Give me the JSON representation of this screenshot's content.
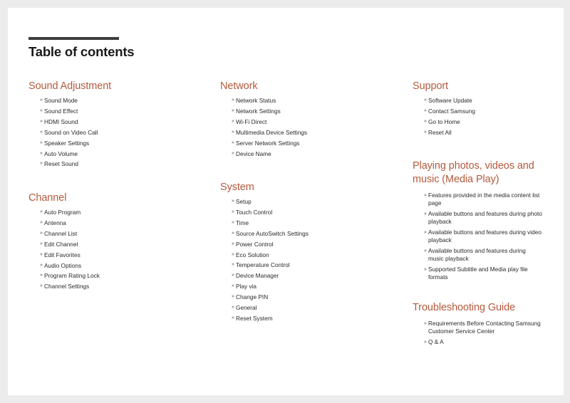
{
  "page": {
    "title": "Table of contents",
    "accent_color": "#b45a3c",
    "bullet_glyph": "»"
  },
  "sections": {
    "sound": {
      "heading": "Sound Adjustment",
      "items": [
        "Sound Mode",
        "Sound Effect",
        "HDMI Sound",
        "Sound on Video Call",
        "Speaker Settings",
        "Auto Volume",
        "Reset Sound"
      ]
    },
    "channel": {
      "heading": "Channel",
      "items": [
        "Auto Program",
        "Antenna",
        "Channel List",
        "Edit Channel",
        "Edit Favorites",
        "Audio Options",
        "Program Rating Lock",
        "Channel Settings"
      ]
    },
    "network": {
      "heading": "Network",
      "items": [
        "Network Status",
        "Network Settings",
        "Wi-Fi Direct",
        "Multimedia Device Settings",
        "Server Network Settings",
        "Device Name"
      ]
    },
    "system": {
      "heading": "System",
      "items": [
        "Setup",
        "Touch Control",
        "Time",
        "Source AutoSwitch Settings",
        "Power Control",
        "Eco Solution",
        "Temperature Control",
        "Device Manager",
        "Play via",
        "Change PIN",
        "General",
        "Reset System"
      ]
    },
    "support": {
      "heading": "Support",
      "items": [
        "Software Update",
        "Contact Samsung",
        "Go to Home",
        "Reset All"
      ]
    },
    "media_play": {
      "heading": "Playing photos, videos and music (Media Play)",
      "items": [
        "Features provided in the media content list page",
        "Available buttons and features during photo playback",
        "Available buttons and features during video playback",
        "Available buttons and features during music playback",
        "Supported Subtitle and Media play file formats"
      ]
    },
    "troubleshooting": {
      "heading": "Troubleshooting Guide",
      "items": [
        "Requirements Before Contacting Samsung Customer Service Center",
        "Q & A"
      ]
    }
  }
}
